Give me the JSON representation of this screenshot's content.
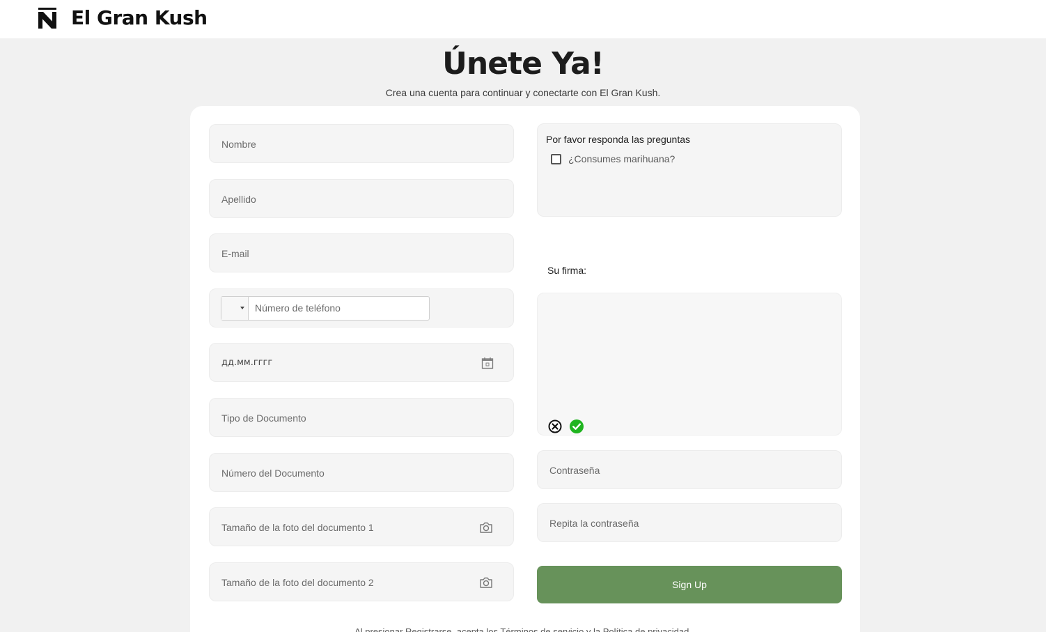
{
  "header": {
    "brand_name": "El Gran Kush"
  },
  "hero": {
    "title": "Únete Ya!",
    "subtitle": "Crea una cuenta para continuar y conectarte con El Gran Kush."
  },
  "form": {
    "first_name_placeholder": "Nombre",
    "last_name_placeholder": "Apellido",
    "email_placeholder": "E-mail",
    "phone_placeholder": "Número de teléfono",
    "date_placeholder": "дд.мм.гггг",
    "doc_type_placeholder": "Tipo de Documento",
    "doc_number_placeholder": "Número del Documento",
    "doc_photo_1_placeholder": "Tamaño de la foto del documento 1",
    "doc_photo_2_placeholder": "Tamaño de la foto del documento 2",
    "questions_title": "Por favor responda las preguntas",
    "question_1_label": "¿Consumes marihuana?",
    "signature_label": "Su firma:",
    "password_placeholder": "Contraseña",
    "repeat_password_placeholder": "Repita la contraseña",
    "signup_label": "Sign Up",
    "terms_text": "Al presionar Registrarse, acepta los Términos de servicio y la Política de privacidad."
  },
  "icons": {
    "logo": "brand-logo-icon",
    "calendar": "calendar-icon",
    "camera": "camera-icon",
    "clear": "clear-signature-icon",
    "confirm": "confirm-signature-icon",
    "dropdown": "chevron-down-icon"
  },
  "colors": {
    "accent": "#67925a",
    "confirm_green": "#1fb41f",
    "background": "#f1f1f1"
  }
}
